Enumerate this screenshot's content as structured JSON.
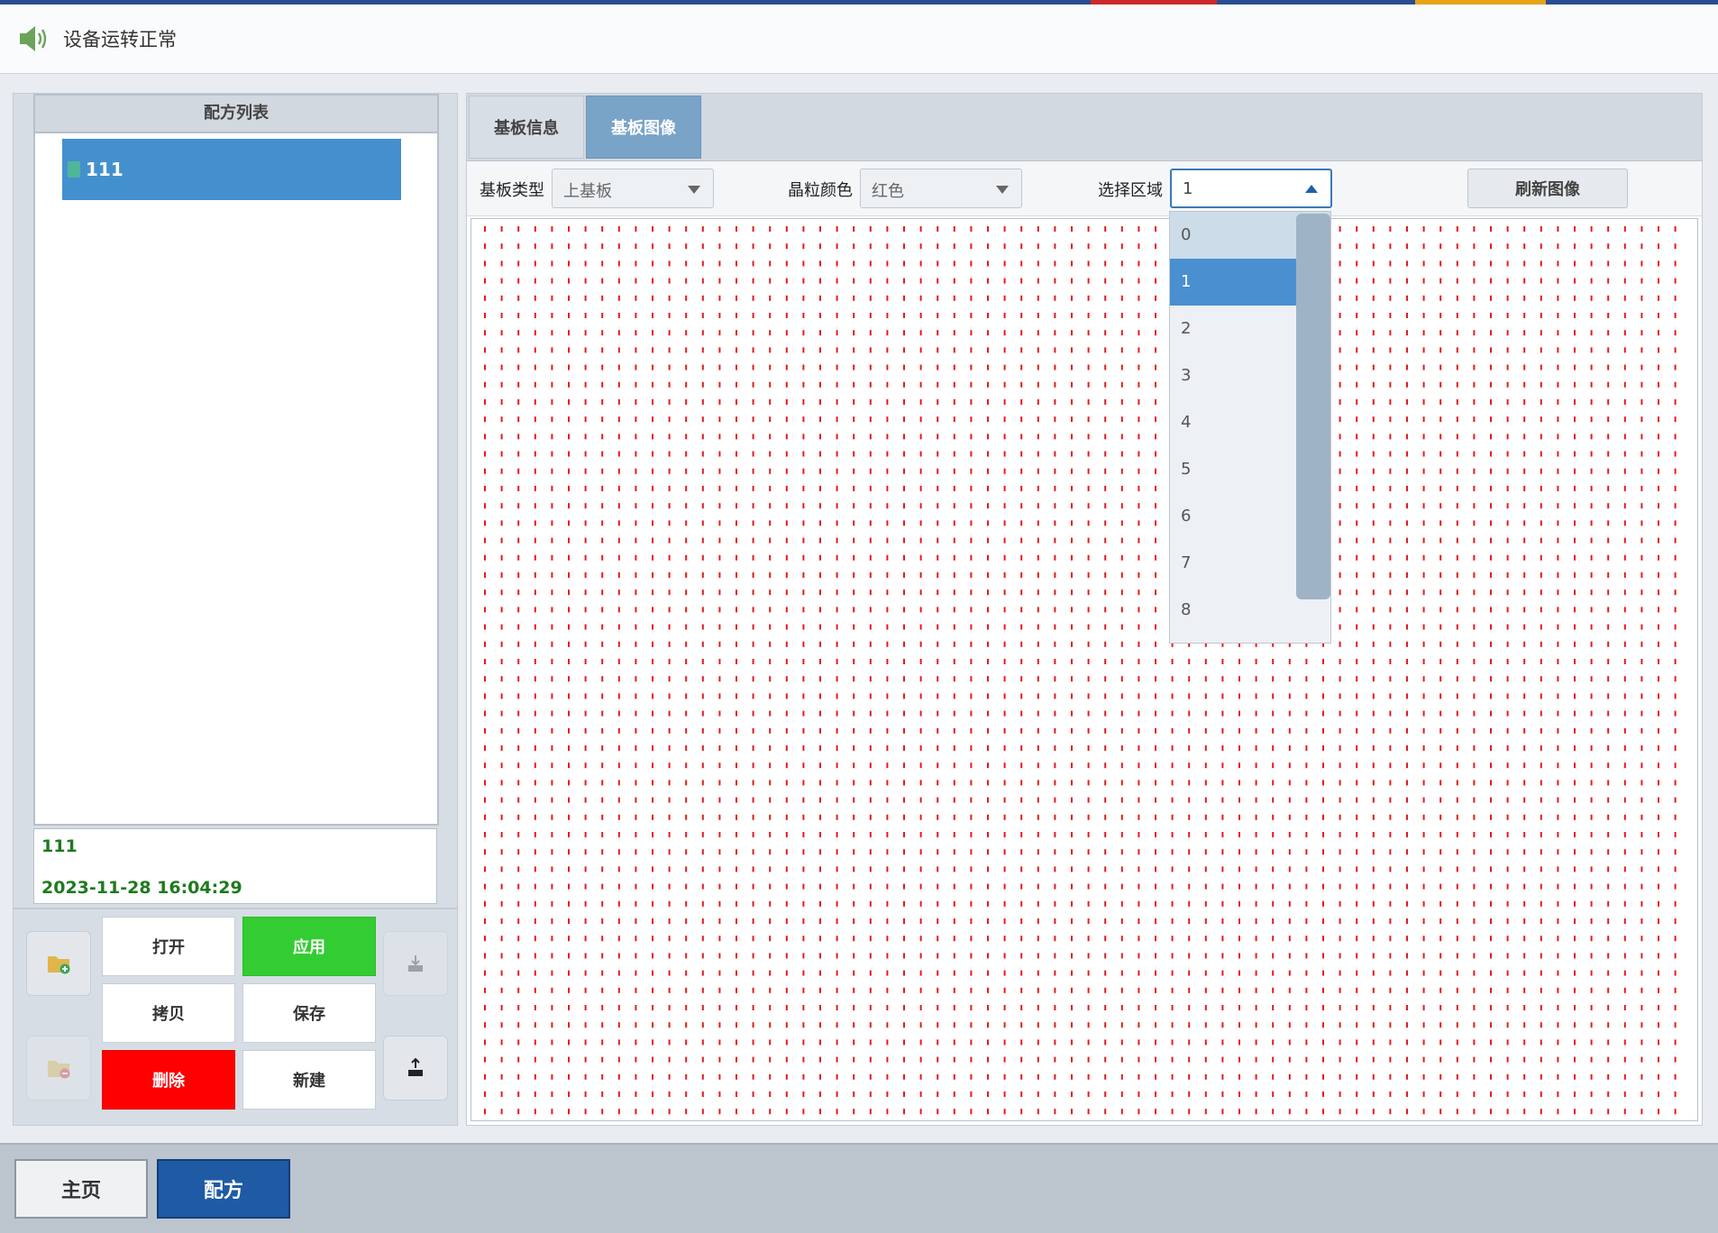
{
  "header": {
    "status_text": "设备运转正常"
  },
  "recipe_list": {
    "title": "配方列表",
    "items": [
      {
        "name": "111",
        "selected": true
      }
    ]
  },
  "info": {
    "name": "111",
    "timestamp": "2023-11-28 16:04:29"
  },
  "buttons": {
    "open": "打开",
    "apply": "应用",
    "copy": "拷贝",
    "save": "保存",
    "delete": "删除",
    "new": "新建"
  },
  "side_icons": {
    "folder_add": "folder-add-icon",
    "folder_remove": "folder-remove-icon",
    "export": "export-icon",
    "import": "import-icon"
  },
  "tabs": [
    {
      "label": "基板信息",
      "active": false
    },
    {
      "label": "基板图像",
      "active": true
    }
  ],
  "toolbar": {
    "substrate_type_label": "基板类型",
    "substrate_type_value": "上基板",
    "die_color_label": "晶粒颜色",
    "die_color_value": "红色",
    "region_label": "选择区域",
    "region_value": "1",
    "refresh_label": "刷新图像"
  },
  "region_options": [
    "0",
    "1",
    "2",
    "3",
    "4",
    "5",
    "6",
    "7",
    "8"
  ],
  "region_selected_index": 1,
  "footer": {
    "home": "主页",
    "recipe": "配方"
  },
  "colors": {
    "accent": "#4a90d0",
    "apply_green": "#33cc33",
    "delete_red": "#ff0000",
    "dot_red": "#e8191b",
    "status_green": "#1e7a1e",
    "footer_active": "#1f5aa5"
  }
}
